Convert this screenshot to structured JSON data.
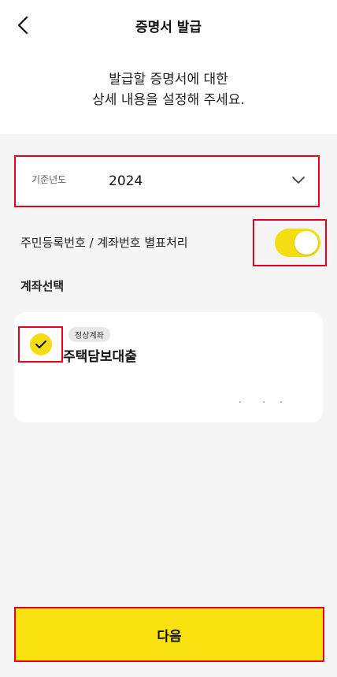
{
  "header": {
    "title": "증명서 발급",
    "back_icon": "chevron-left-icon"
  },
  "intro": {
    "line1": "발급할 증명서에 대한",
    "line2": "상세 내용을 설정해 주세요."
  },
  "year_select": {
    "label": "기준년도",
    "value": "2024",
    "icon": "chevron-down-icon"
  },
  "masking": {
    "label": "주민등록번호 / 계좌번호 별표처리",
    "enabled": true
  },
  "accounts": {
    "title": "계좌선택",
    "items": [
      {
        "badge": "정상계좌",
        "name": "주택담보대출",
        "selected": true
      }
    ]
  },
  "footer": {
    "next_label": "다음"
  },
  "colors": {
    "accent_yellow": "#f4dd11",
    "highlight_red": "#e6001f",
    "background": "#f5f5f5"
  }
}
